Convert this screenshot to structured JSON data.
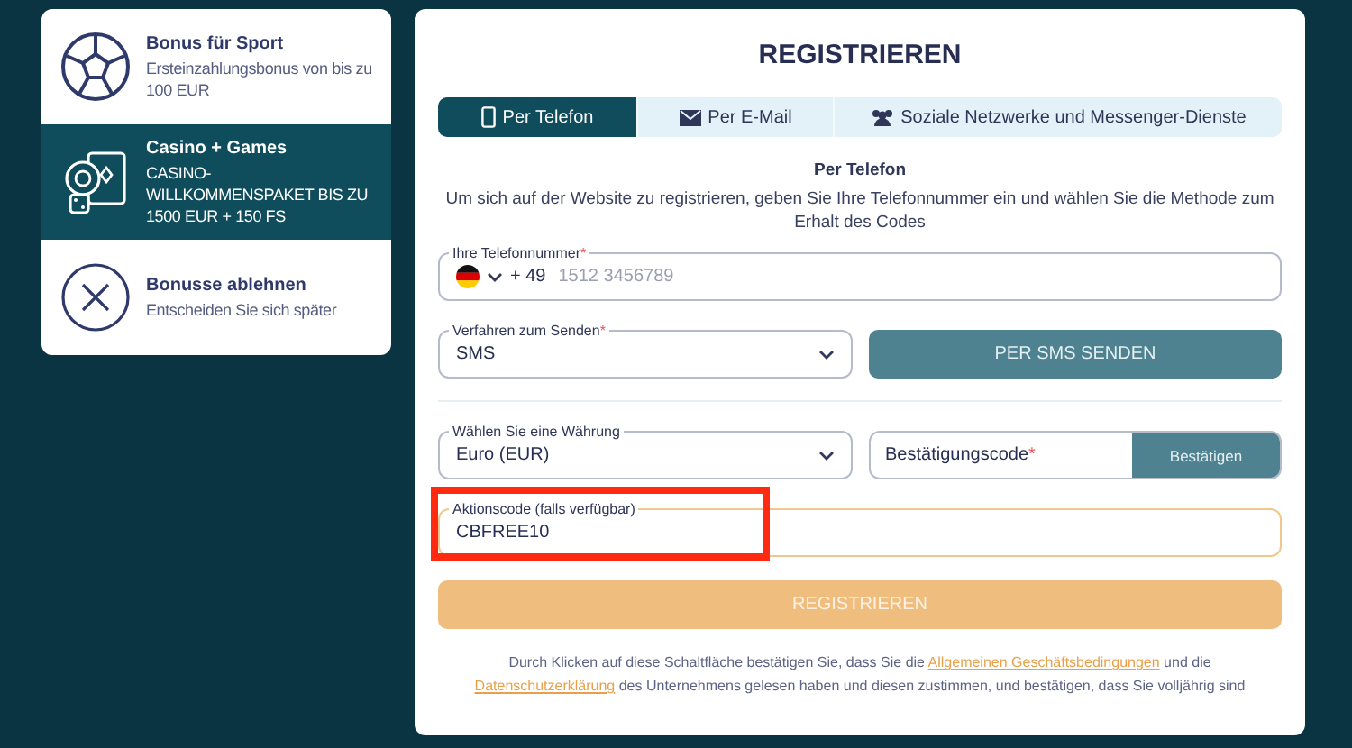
{
  "bonuses": [
    {
      "kind": "sport",
      "title": "Bonus für Sport",
      "subtitle": "Ersteinzahlungsbonus von bis zu 100 EUR",
      "selected": false
    },
    {
      "kind": "casino",
      "title": "Casino + Games",
      "subtitle": "CASINO-WILLKOMMENSPAKET BIS ZU 1500 EUR + 150 FS",
      "selected": true
    },
    {
      "kind": "decline",
      "title": "Bonusse ablehnen",
      "subtitle": "Entscheiden Sie sich später",
      "selected": false
    }
  ],
  "form": {
    "title": "REGISTRIEREN",
    "tabs": [
      {
        "kind": "phone",
        "label": "Per Telefon",
        "selected": true
      },
      {
        "kind": "email",
        "label": "Per E-Mail",
        "selected": false
      },
      {
        "kind": "social",
        "label": "Soziale Netzwerke und Messenger-Dienste",
        "selected": false
      }
    ],
    "heading": "Per Telefon",
    "description": "Um sich auf der Website zu registrieren, geben Sie Ihre Telefonnummer ein und wählen Sie die Methode zum Erhalt des Codes",
    "required_mark": "*",
    "phone": {
      "label": "Ihre Telefonnummer",
      "required": true,
      "prefix": "+ 49",
      "placeholder": "1512 3456789"
    },
    "send_method": {
      "label": "Verfahren zum Senden",
      "required": true,
      "value": "SMS"
    },
    "send_button": "PER SMS SENDEN",
    "currency": {
      "label": "Wählen Sie eine Währung",
      "required": false,
      "value": "Euro (EUR)"
    },
    "confirmation": {
      "placeholder": "Bestätigungscode",
      "required": true,
      "button": "Bestätigen"
    },
    "promo": {
      "label": "Aktionscode (falls verfügbar)",
      "value": "CBFREE10",
      "highlighted": true
    },
    "submit": "REGISTRIEREN",
    "legal": {
      "before": "Durch Klicken auf diese Schaltfläche bestätigen Sie, dass Sie die ",
      "link_1": "Allgemeinen Geschäftsbedingungen",
      "middle": " und die ",
      "link_2": "Datenschutzerklärung",
      "after": " des Unternehmens gelesen haben und diesen zustimmen, und bestätigen, dass Sie volljährig sind"
    }
  }
}
